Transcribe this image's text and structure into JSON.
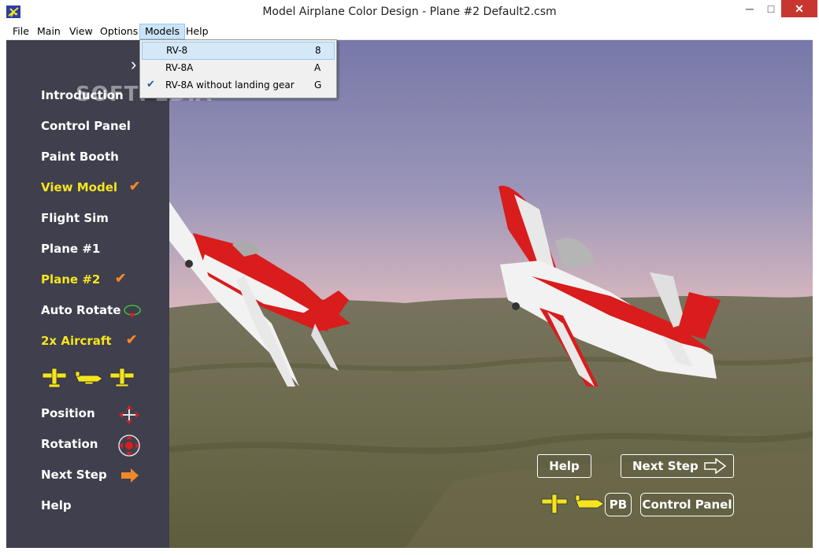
{
  "window": {
    "title": "Model Airplane Color Design - Plane #2  Default2.csm",
    "minimize_glyph": "─",
    "maximize_glyph": "□",
    "close_glyph": "✕"
  },
  "menubar": {
    "items": [
      "File",
      "Main",
      "View",
      "Options",
      "Models",
      "Help"
    ]
  },
  "models_menu": {
    "items": [
      {
        "label": "RV-8",
        "shortcut": "8",
        "checked": false
      },
      {
        "label": "RV-8A",
        "shortcut": "A",
        "checked": false
      },
      {
        "label": "RV-8A without landing gear",
        "shortcut": "G",
        "checked": true
      }
    ],
    "check_glyph": "✔"
  },
  "sidebar": {
    "chevron": "›",
    "watermark": "SOFTPEDIA",
    "items": [
      {
        "label": "Introduction",
        "active": false
      },
      {
        "label": "Control Panel",
        "active": false
      },
      {
        "label": "Paint Booth",
        "active": false
      },
      {
        "label": "View Model",
        "active": true
      },
      {
        "label": "Flight Sim",
        "active": false
      },
      {
        "label": "Plane #1",
        "active": false
      },
      {
        "label": "Plane #2",
        "active": true
      },
      {
        "label": "Auto Rotate",
        "active": false
      },
      {
        "label": "2x Aircraft",
        "active": true
      },
      {
        "label": "Position",
        "active": false
      },
      {
        "label": "Rotation",
        "active": false
      },
      {
        "label": "Next Step",
        "active": false
      },
      {
        "label": "Help",
        "active": false
      }
    ],
    "check_glyph": "✔"
  },
  "overlay": {
    "help_label": "Help",
    "next_step_label": "Next Step",
    "pb_label": "PB",
    "control_panel_label": "Control Panel"
  },
  "colors": {
    "sidebar_bg": "#3f3f4d",
    "active_text": "#f5e51e",
    "check": "#f0882a",
    "plane_red": "#d91c1c",
    "plane_white": "#f2f2f2"
  }
}
